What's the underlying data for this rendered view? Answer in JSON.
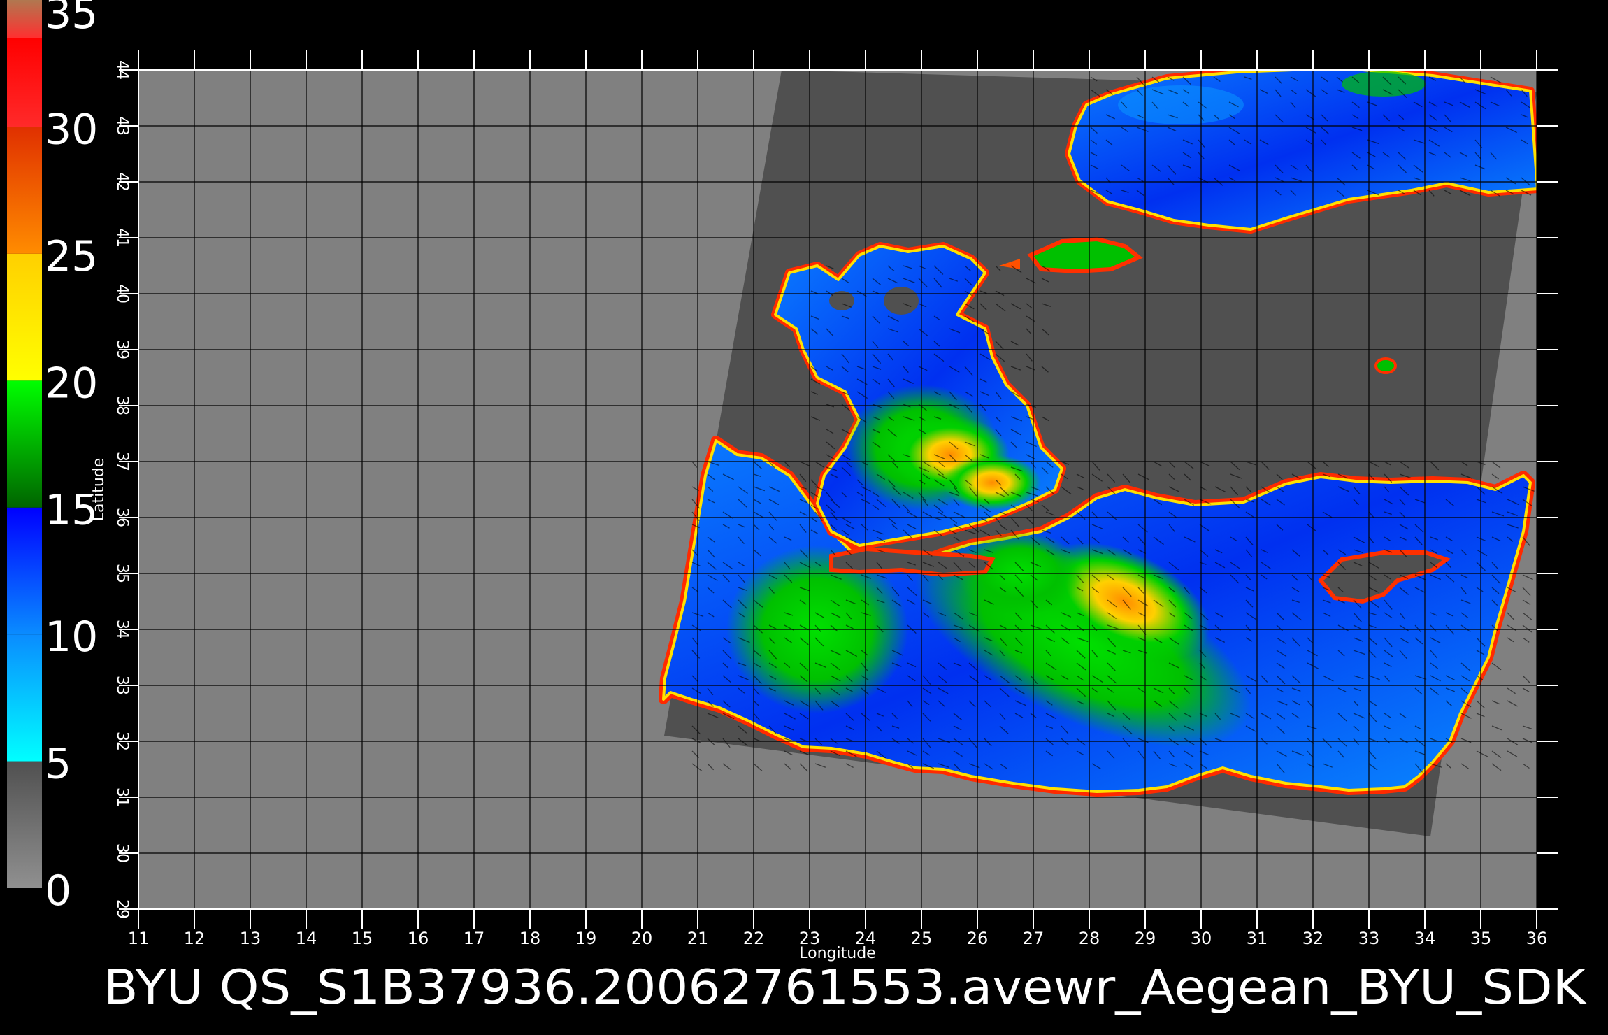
{
  "colorbar": {
    "ticks": [
      "35",
      "30",
      "25",
      "20",
      "15",
      "10",
      "5",
      "0"
    ],
    "min": 0,
    "max": 35,
    "stops": [
      {
        "from": 0,
        "to": 5,
        "color_top": "#505050",
        "color_bottom": "#909090"
      },
      {
        "from": 5,
        "to": 10,
        "color_top": "#0a8cff",
        "color_bottom": "#00ffff"
      },
      {
        "from": 10,
        "to": 15,
        "color_top": "#0000ff",
        "color_bottom": "#0a8cff"
      },
      {
        "from": 15,
        "to": 20,
        "color_top": "#00ff00",
        "color_bottom": "#006400"
      },
      {
        "from": 20,
        "to": 25,
        "color_top": "#ffd000",
        "color_bottom": "#ffff00"
      },
      {
        "from": 25,
        "to": 30,
        "color_top": "#e03000",
        "color_bottom": "#ff8c00"
      },
      {
        "from": 30,
        "to": 33.5,
        "color_top": "#ff0000",
        "color_bottom": "#ff2a2a"
      },
      {
        "from": 33.5,
        "to": 35,
        "color_top": "#b07850",
        "color_bottom": "#ff3030"
      }
    ]
  },
  "map": {
    "x_axis_label": "Longitude",
    "y_axis_label": "Latitude",
    "lon_range": [
      11,
      36
    ],
    "lat_range": [
      29,
      44
    ],
    "lon_ticks": [
      "11",
      "12",
      "13",
      "14",
      "15",
      "16",
      "17",
      "18",
      "19",
      "20",
      "21",
      "22",
      "23",
      "24",
      "25",
      "26",
      "27",
      "28",
      "29",
      "30",
      "31",
      "32",
      "33",
      "34",
      "35",
      "36"
    ],
    "lat_ticks": [
      "29",
      "30",
      "31",
      "32",
      "33",
      "34",
      "35",
      "36",
      "37",
      "38",
      "39",
      "40",
      "41",
      "42",
      "43",
      "44"
    ],
    "background_color": "#808080",
    "swath_color": "#505050",
    "grid_color": "#000000",
    "swath_corners_lonlat": [
      [
        22.5,
        44
      ],
      [
        36,
        43.6
      ],
      [
        34.1,
        30.3
      ],
      [
        20.4,
        32.1
      ]
    ]
  },
  "footer": {
    "caption": "BYU  QS_S1B37936.20062761553.avewr_Aegean_BYU_SDK"
  }
}
